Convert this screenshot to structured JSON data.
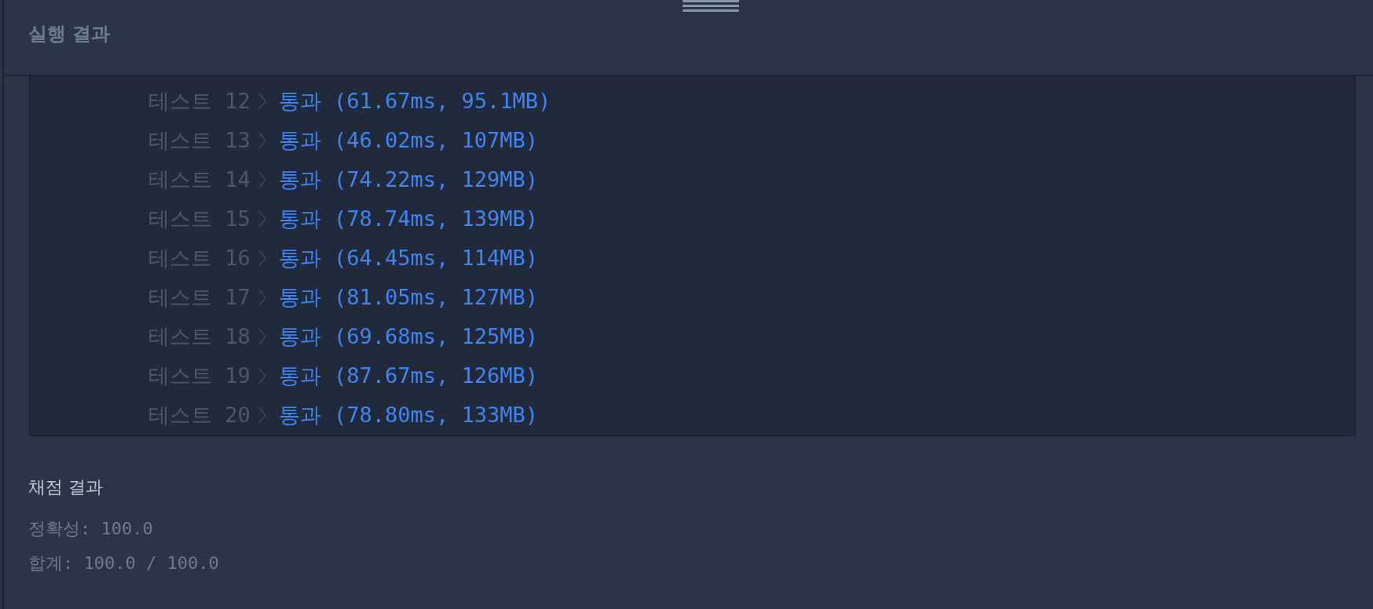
{
  "panel": {
    "title": "실행 결과"
  },
  "output": {
    "rows": [
      {
        "label": "테스트 12",
        "result": "통과 (61.67ms, 95.1MB)"
      },
      {
        "label": "테스트 13",
        "result": "통과 (46.02ms, 107MB)"
      },
      {
        "label": "테스트 14",
        "result": "통과 (74.22ms, 129MB)"
      },
      {
        "label": "테스트 15",
        "result": "통과 (78.74ms, 139MB)"
      },
      {
        "label": "테스트 16",
        "result": "통과 (64.45ms, 114MB)"
      },
      {
        "label": "테스트 17",
        "result": "통과 (81.05ms, 127MB)"
      },
      {
        "label": "테스트 18",
        "result": "통과 (69.68ms, 125MB)"
      },
      {
        "label": "테스트 19",
        "result": "통과 (87.67ms, 126MB)"
      },
      {
        "label": "테스트 20",
        "result": "통과 (78.80ms, 133MB)"
      }
    ]
  },
  "grading": {
    "title": "채점 결과",
    "lines": [
      "정확성: 100.0",
      "합계: 100.0 / 100.0"
    ]
  }
}
